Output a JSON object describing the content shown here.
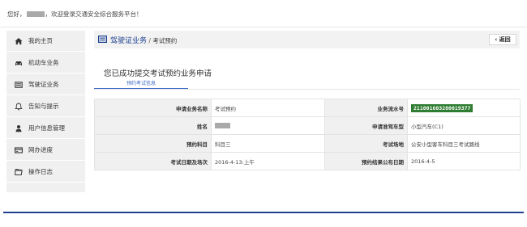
{
  "header": {
    "greeting_prefix": "您好，",
    "greeting_suffix": "，欢迎登录交通安全综合服务平台！"
  },
  "sidebar": {
    "items": [
      {
        "label": "我的主页",
        "icon": "home-icon"
      },
      {
        "label": "机动车业务",
        "icon": "car-icon"
      },
      {
        "label": "驾驶证业务",
        "icon": "license-card-icon"
      },
      {
        "label": "告知与提示",
        "icon": "bell-icon"
      },
      {
        "label": "用户信息管理",
        "icon": "user-icon"
      },
      {
        "label": "网办进度",
        "icon": "progress-card-icon"
      },
      {
        "label": "操作日志",
        "icon": "log-icon"
      }
    ]
  },
  "main": {
    "title": "驾驶证业务",
    "separator": " / ",
    "subtitle": "考试预约",
    "back_label": "‹ 返回",
    "success_message": "您已成功提交考试预约业务申请",
    "tab_label": "预约考试信息",
    "rows": [
      {
        "l1": "申请业务名称",
        "v1": "考试预约",
        "l2": "业务流水号",
        "v2": "211001603280019377"
      },
      {
        "l1": "姓名",
        "v1": "",
        "l2": "申请准驾车型",
        "v2": "小型汽车(C1)"
      },
      {
        "l1": "预约科目",
        "v1": "科目三",
        "l2": "考试场地",
        "v2": "公安小型客车科目三考试路线"
      },
      {
        "l1": "考试日期及场次",
        "v1": "2016-4-13:上午",
        "l2": "预约结果公布日期",
        "v2": "2016-4-5"
      }
    ]
  },
  "colors": {
    "accent": "#1a3e8e",
    "tab": "#3f68c8",
    "serial_badge": "#2f7d32",
    "sidebar_bg": "#f0f0f0"
  }
}
